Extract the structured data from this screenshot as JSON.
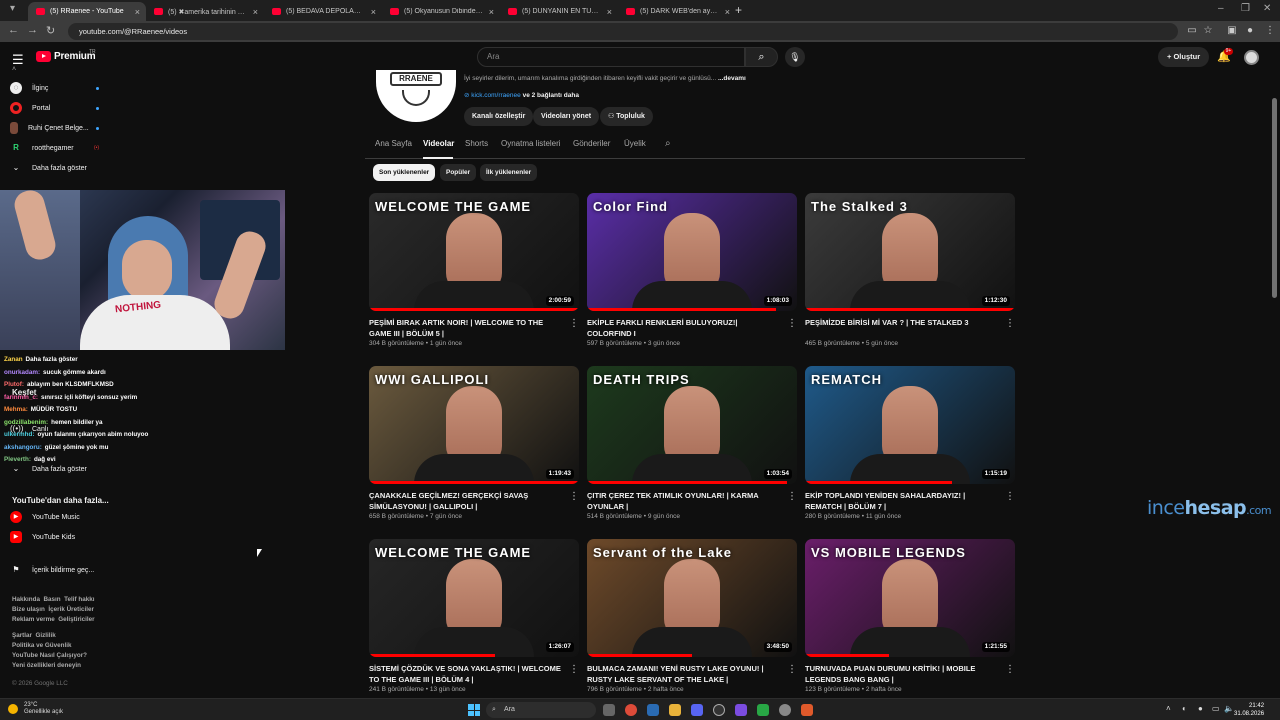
{
  "browser": {
    "tabs": [
      {
        "title": "(5) RRaenee - YouTube",
        "active": true
      },
      {
        "title": "(5) ✖amerika tarihinin EN RE"
      },
      {
        "title": "(5) BEDAVA DEPOLARDA YILIN"
      },
      {
        "title": "(5) Okyanusun Dibinde Oksijen"
      },
      {
        "title": "(5) DÜNYANIN EN TUHAF NÜK"
      },
      {
        "title": "(5) DARK WEB'den ayakkabı SI"
      }
    ],
    "new_tab": "+",
    "url": "youtube.com/@RRaenee/videos"
  },
  "header": {
    "logo": "Premium",
    "logo_region": "TR",
    "search_placeholder": "Ara",
    "create_label": "Oluştur",
    "notification_count": "9+"
  },
  "sidebar": {
    "subscriptions": [
      {
        "label": "İlginç",
        "icon": "avatar-icon",
        "live": true
      },
      {
        "label": "Portal",
        "icon": "avatar-icon",
        "live": true
      },
      {
        "label": "Ruhi Çenet Belge...",
        "icon": "avatar-icon",
        "live": true
      },
      {
        "label": "rootthegamer",
        "icon": "avatar-icon",
        "live": false,
        "badge": "(•)"
      }
    ],
    "show_more": "Daha fazla göster",
    "explore_head": "Keşfet",
    "explore_items": [
      {
        "label": "Canlı",
        "icon": "live-icon"
      }
    ],
    "show_more_2": "Daha fazla göster",
    "more_from_yt_head": "YouTube'dan daha fazla...",
    "more_from_yt": [
      {
        "label": "YouTube Music",
        "icon": "youtube-music-icon"
      },
      {
        "label": "YouTube Kids",
        "icon": "youtube-kids-icon"
      }
    ],
    "report_history": "İçerik bildirme geç...",
    "footer_1": [
      "Hakkında",
      "Basın",
      "Telif hakkı"
    ],
    "footer_2": [
      "Bize ulaşın",
      "İçerik Üreticiler"
    ],
    "footer_3": [
      "Reklam verme",
      "Geliştiriciler"
    ],
    "footer_4": [
      "Şartlar",
      "Gizlilik"
    ],
    "footer_5": "Politika ve Güvenlik",
    "footer_6": "YouTube Nasıl Çalışıyor?",
    "footer_7": "Yeni özellikleri deneyin",
    "copyright": "© 2026 Google LLC"
  },
  "chat": [
    {
      "user": "Zanan",
      "msg": "Daha fazla göster"
    },
    {
      "user": "onurkadam:",
      "msg": "sucuk gömme akardı"
    },
    {
      "user": "Plutof:",
      "msg": "ablayım ben KLSDMFLKMSD"
    },
    {
      "user": "farinmin_c:",
      "msg": "sınırsız içli köfteyi sonsuz yerim"
    },
    {
      "user": "Mehma:",
      "msg": "MÜDÜR TOSTU"
    },
    {
      "user": "godzillabenim:",
      "msg": "hemen bildiler ya"
    },
    {
      "user": "ulkermhd:",
      "msg": "oyun falanmı çıkarıyon abim noluyoo"
    },
    {
      "user": "akshangoru:",
      "msg": "güzel şömine yok mu"
    },
    {
      "user": "Pleverth:",
      "msg": "dağ evi"
    }
  ],
  "channel": {
    "avatar_text": "RRAENE",
    "description": "İyi seyirler dilerim, umarım kanalıma girdiğinden itibaren keyifli vakit geçirir ve günlüsü...",
    "more": "...devamı",
    "link": "kick.com/rraenee",
    "link_more": "ve 2 bağlantı daha",
    "buttons": [
      "Kanalı özelleştir",
      "Videoları yönet",
      "Topluluk"
    ],
    "tabs": [
      "Ana Sayfa",
      "Videolar",
      "Shorts",
      "Oynatma listeleri",
      "Gönderiler",
      "Üyelik"
    ],
    "active_tab": "Videolar",
    "chips": [
      "Son yüklenenler",
      "Popüler",
      "İlk yüklenenler"
    ]
  },
  "videos": [
    {
      "title": "PEŞİMİ BIRAK ARTIK NOIR! | WELCOME TO THE GAME III | BÖLÜM 5 |",
      "views": "304 B görüntüleme",
      "age": "1 gün önce",
      "duration": "2:00:59",
      "thumb_text": "WELCOME THE GAME",
      "bg": "#2a2a2a",
      "progress": 1.0
    },
    {
      "title": "EKİPLE FARKLI RENKLERİ BULUYORUZ!| COLORFIND I",
      "views": "597 B görüntüleme",
      "age": "3 gün önce",
      "duration": "1:08:03",
      "thumb_text": "Color Find",
      "bg": "#5a2ea8",
      "progress": 0.9
    },
    {
      "title": "PEŞİMİZDE BİRİSİ Mİ VAR ? | THE STALKED 3",
      "views": "465 B görüntüleme",
      "age": "5 gün önce",
      "duration": "1:12:30",
      "thumb_text": "The Stalked 3",
      "bg": "#3b3b3b",
      "progress": 1.0
    },
    {
      "title": "ÇANAKKALE GEÇİLMEZ! GERÇEKÇİ SAVAŞ SİMÜLASYONU! | GALLIPOLI |",
      "views": "658 B görüntüleme",
      "age": "7 gün önce",
      "duration": "1:19:43",
      "thumb_text": "WWI GALLIPOLI",
      "bg": "#6b5a3e",
      "progress": 1.0
    },
    {
      "title": "ÇITIR ÇEREZ TEK ATIMLIK OYUNLAR! | KARMA OYUNLAR |",
      "views": "514 B görüntüleme",
      "age": "9 gün önce",
      "duration": "1:03:54",
      "thumb_text": "DEATH TRIPS",
      "bg": "#1d3a1d",
      "progress": 0.95
    },
    {
      "title": "EKİP TOPLANDI YENİDEN SAHALARDAYIZ! | REMATCH | BÖLÜM 7 |",
      "views": "280 B görüntüleme",
      "age": "11 gün önce",
      "duration": "1:15:19",
      "thumb_text": "REMATCH",
      "bg": "#1f5a8a",
      "progress": 0.7
    },
    {
      "title": "SİSTEMİ ÇÖZDÜK VE SONA YAKLAŞTIK! | WELCOME TO THE GAME III | BÖLÜM 4 |",
      "views": "241 B görüntüleme",
      "age": "13 gün önce",
      "duration": "1:26:07",
      "thumb_text": "WELCOME THE GAME",
      "bg": "#262626",
      "progress": 0.6
    },
    {
      "title": "BULMACA ZAMANI! YENİ RUSTY LAKE OYUNU! | RUSTY LAKE SERVANT OF THE LAKE |",
      "views": "796 B görüntüleme",
      "age": "2 hafta önce",
      "duration": "3:48:50",
      "thumb_text": "Servant of the Lake",
      "bg": "#6e4a2a",
      "progress": 0.5
    },
    {
      "title": "TURNUVADA PUAN DURUMU KRİTİK! | MOBILE LEGENDS BANG BANG |",
      "views": "123 B görüntüleme",
      "age": "2 hafta önce",
      "duration": "1:21:55",
      "thumb_text": "VS MOBILE LEGENDS",
      "bg": "#6a1e6a",
      "progress": 0.4
    }
  ],
  "watermark": {
    "a": "ince",
    "b": "hesap",
    "c": ".com"
  },
  "taskbar": {
    "temp": "23°C",
    "weather": "Genellikle açık",
    "search": "Ara",
    "time": "21:42",
    "date": "31.08.2026"
  }
}
